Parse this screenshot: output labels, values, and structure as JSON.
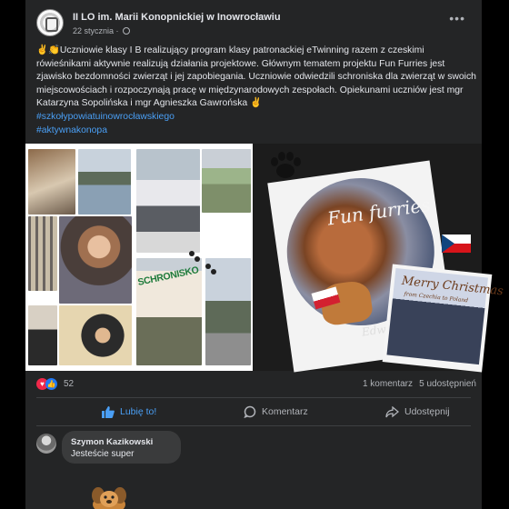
{
  "post": {
    "page_name": "II LO im. Marii Konopnickiej w Inowrocławiu",
    "date": "22 stycznia",
    "separator": "·",
    "more_label": "•••",
    "icons": {
      "page_avatar": "school-crest-icon",
      "privacy": "globe-icon",
      "more": "more-options-icon"
    }
  },
  "text": {
    "body": "✌️👏Uczniowie klasy I B realizujący  program klasy patronackiej eTwinning razem z czeskimi rówieśnikami aktywnie realizują działania projektowe. Głównym tematem projektu Fun Furries jest zjawisko bezdomności zwierząt i jej zapobiegania. Uczniowie odwiedzili schroniska dla zwierząt w swoich miejscowościach i rozpoczynają pracę w międzynarodowych zespołach. Opiekunami uczniów jest mgr Katarzyna Sopolińska i mgr Agnieszka Gawrońska ✌️",
    "hashtags": [
      "#szkołypowiatuinowrocławskiego",
      "#aktywnakonopa"
    ]
  },
  "media": {
    "collage_sign": "SCHRONISKO",
    "poster_title": "Fun furries",
    "poster_signature": "Edwin",
    "card_title": "Merry Christmas",
    "card_subtitle": "from Czechia to Poland"
  },
  "stats": {
    "reaction_count": "52",
    "comments": "1 komentarz",
    "shares": "5 udostępnień",
    "reaction_icons": [
      "heart-icon",
      "like-icon"
    ]
  },
  "actions": {
    "like": "Lubię to!",
    "comment": "Komentarz",
    "share": "Udostępnij"
  },
  "comment": {
    "author": "Szymon Kazikowski",
    "text": "Jesteście super",
    "sticker": "dog-sticker"
  },
  "colors": {
    "card_bg": "#242526",
    "accent": "#4a9ff5",
    "text": "#e4e6eb",
    "muted": "#b0b3b8",
    "like_red": "#f0284a",
    "like_blue": "#2078f4"
  }
}
